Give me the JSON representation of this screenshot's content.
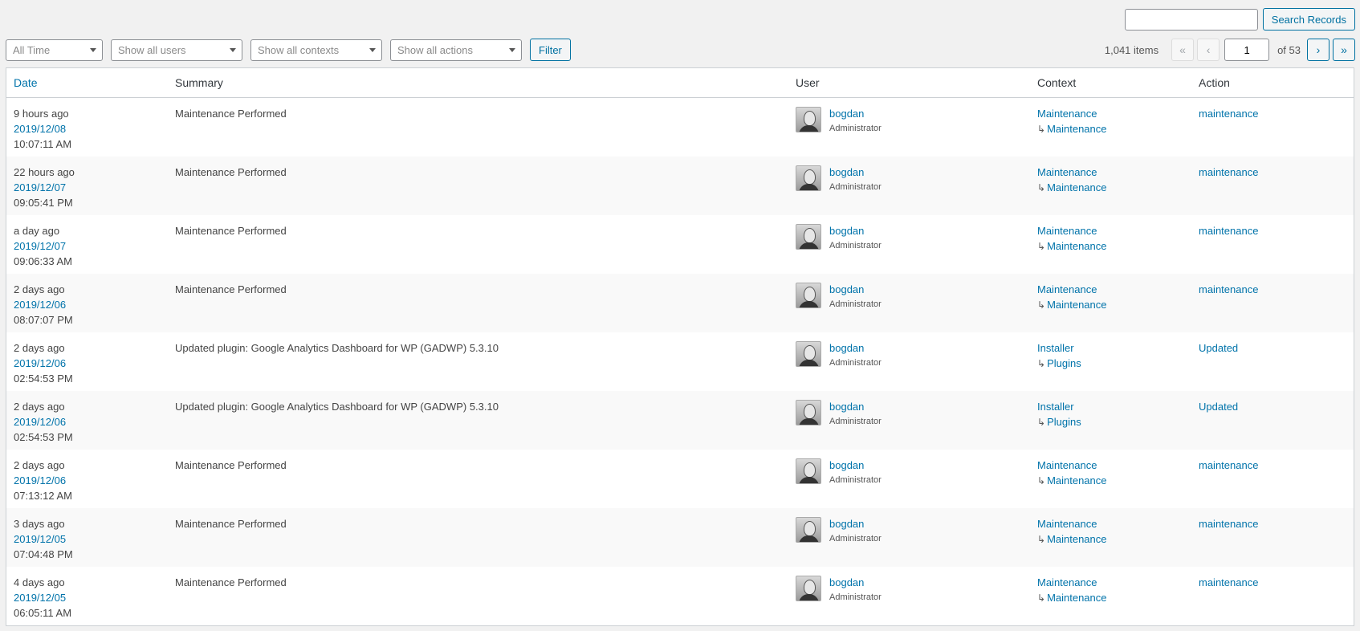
{
  "search": {
    "button_label": "Search Records",
    "value": ""
  },
  "filters": {
    "time": "All Time",
    "users": "Show all users",
    "contexts": "Show all contexts",
    "actions": "Show all actions",
    "button_label": "Filter"
  },
  "pagination": {
    "items_count": "1,041 items",
    "first": "«",
    "prev": "‹",
    "current_page": "1",
    "of_label": "of 53",
    "next": "›",
    "last": "»"
  },
  "table": {
    "columns": [
      "Date",
      "Summary",
      "User",
      "Context",
      "Action"
    ],
    "rows": [
      {
        "relative": "9 hours ago",
        "date": "2019/12/08",
        "time": "10:07:11 AM",
        "summary": "Maintenance Performed",
        "user": "bogdan",
        "role": "Administrator",
        "context": "Maintenance",
        "context_sub": "Maintenance",
        "action": "maintenance"
      },
      {
        "relative": "22 hours ago",
        "date": "2019/12/07",
        "time": "09:05:41 PM",
        "summary": "Maintenance Performed",
        "user": "bogdan",
        "role": "Administrator",
        "context": "Maintenance",
        "context_sub": "Maintenance",
        "action": "maintenance"
      },
      {
        "relative": "a day ago",
        "date": "2019/12/07",
        "time": "09:06:33 AM",
        "summary": "Maintenance Performed",
        "user": "bogdan",
        "role": "Administrator",
        "context": "Maintenance",
        "context_sub": "Maintenance",
        "action": "maintenance"
      },
      {
        "relative": "2 days ago",
        "date": "2019/12/06",
        "time": "08:07:07 PM",
        "summary": "Maintenance Performed",
        "user": "bogdan",
        "role": "Administrator",
        "context": "Maintenance",
        "context_sub": "Maintenance",
        "action": "maintenance"
      },
      {
        "relative": "2 days ago",
        "date": "2019/12/06",
        "time": "02:54:53 PM",
        "summary": "Updated plugin: Google Analytics Dashboard for WP (GADWP) 5.3.10",
        "user": "bogdan",
        "role": "Administrator",
        "context": "Installer",
        "context_sub": "Plugins",
        "action": "Updated"
      },
      {
        "relative": "2 days ago",
        "date": "2019/12/06",
        "time": "02:54:53 PM",
        "summary": "Updated plugin: Google Analytics Dashboard for WP (GADWP) 5.3.10",
        "user": "bogdan",
        "role": "Administrator",
        "context": "Installer",
        "context_sub": "Plugins",
        "action": "Updated"
      },
      {
        "relative": "2 days ago",
        "date": "2019/12/06",
        "time": "07:13:12 AM",
        "summary": "Maintenance Performed",
        "user": "bogdan",
        "role": "Administrator",
        "context": "Maintenance",
        "context_sub": "Maintenance",
        "action": "maintenance"
      },
      {
        "relative": "3 days ago",
        "date": "2019/12/05",
        "time": "07:04:48 PM",
        "summary": "Maintenance Performed",
        "user": "bogdan",
        "role": "Administrator",
        "context": "Maintenance",
        "context_sub": "Maintenance",
        "action": "maintenance"
      },
      {
        "relative": "4 days ago",
        "date": "2019/12/05",
        "time": "06:05:11 AM",
        "summary": "Maintenance Performed",
        "user": "bogdan",
        "role": "Administrator",
        "context": "Maintenance",
        "context_sub": "Maintenance",
        "action": "maintenance"
      }
    ]
  }
}
